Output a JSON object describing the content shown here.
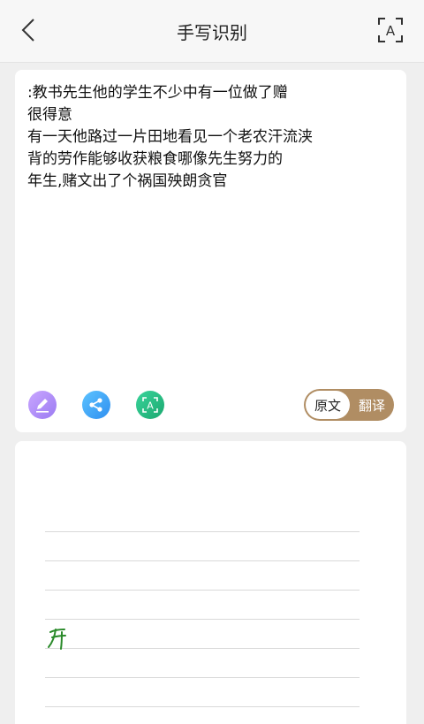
{
  "header": {
    "title": "手写识别",
    "back_icon": "chevron-left-icon",
    "scan_icon": "text-scan-icon"
  },
  "result": {
    "text": ":教书先生他的学生不少中有一位做了赠\n很得意\n有一天他路过一片田地看见一个老农汗流浃\n背的劳作能够收获粮食哪像先生努力的\n年生,赌文出了个祸国殃朗贪官"
  },
  "tools": {
    "edit_icon": "pencil-icon",
    "share_icon": "share-icon",
    "ocr_icon": "text-recognize-icon"
  },
  "toggle": {
    "original_label": "原文",
    "translate_label": "翻译",
    "selected": "原文",
    "track_color": "#b08d63"
  },
  "canvas": {
    "stroke_color": "#2a8a2a"
  }
}
